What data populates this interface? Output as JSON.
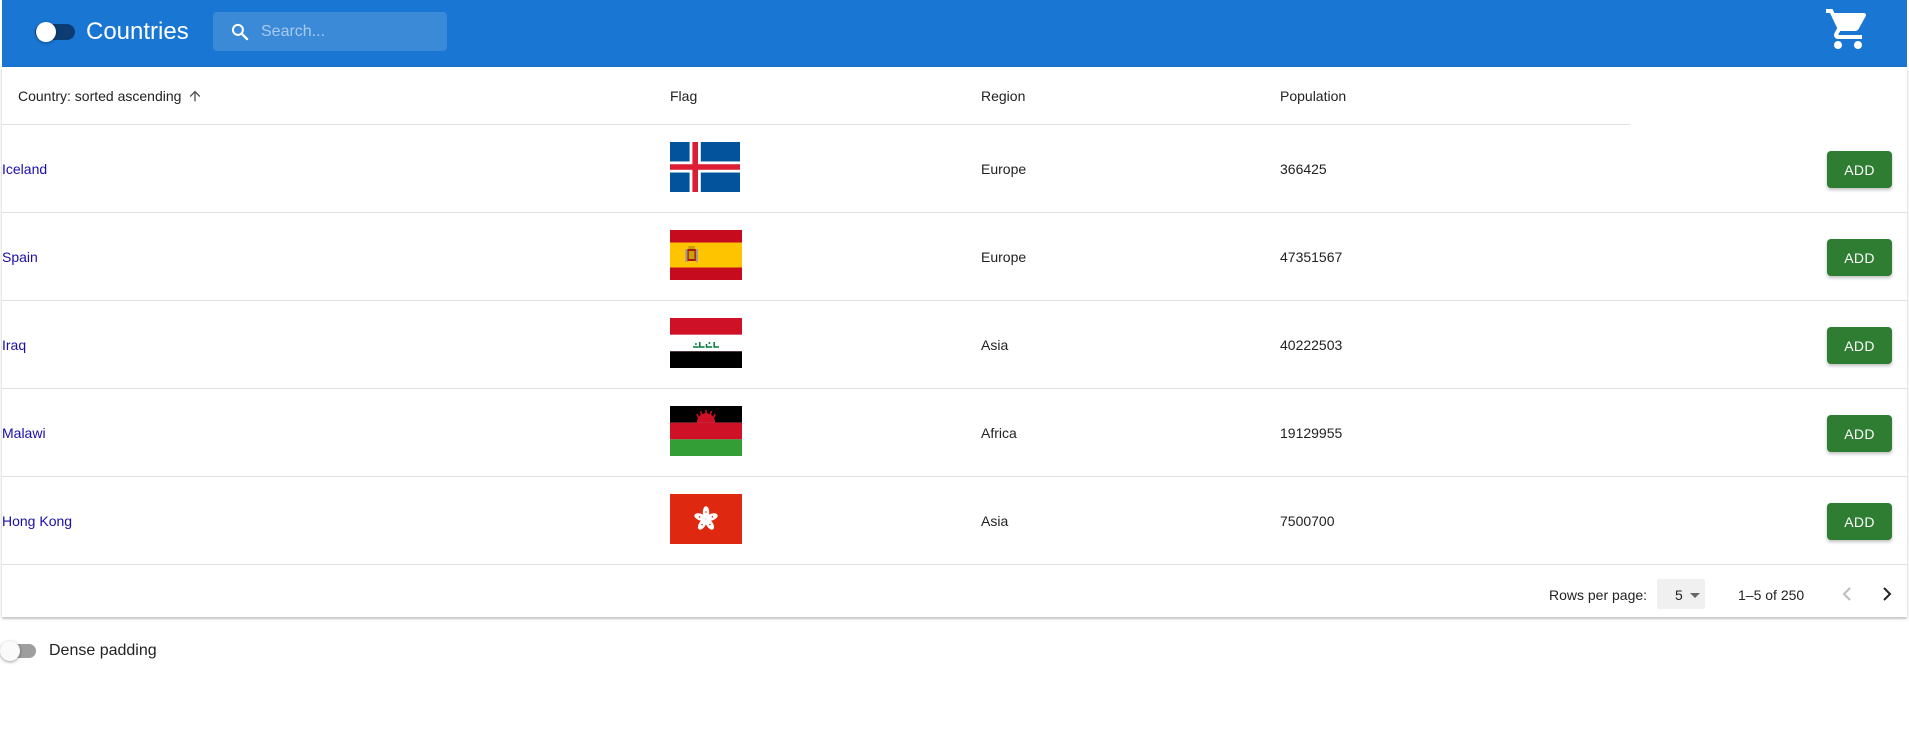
{
  "appbar": {
    "title": "Countries",
    "search_placeholder": "Search...",
    "icons": [
      "search-icon",
      "cart-icon"
    ],
    "color": "#1976d2"
  },
  "table": {
    "columns": {
      "country": "Country: sorted ascending",
      "flag": "Flag",
      "region": "Region",
      "population": "Population"
    },
    "sort": {
      "column": "country",
      "direction": "ascending"
    },
    "rows": [
      {
        "country": "Iceland",
        "flag": "iceland",
        "region": "Europe",
        "population": "366425",
        "action": "ADD"
      },
      {
        "country": "Spain",
        "flag": "spain",
        "region": "Europe",
        "population": "47351567",
        "action": "ADD"
      },
      {
        "country": "Iraq",
        "flag": "iraq",
        "region": "Asia",
        "population": "40222503",
        "action": "ADD"
      },
      {
        "country": "Malawi",
        "flag": "malawi",
        "region": "Africa",
        "population": "19129955",
        "action": "ADD"
      },
      {
        "country": "Hong Kong",
        "flag": "hong-kong",
        "region": "Asia",
        "population": "7500700",
        "action": "ADD"
      }
    ],
    "add_button_color": "#2e7d32",
    "link_color": "#1a0dab"
  },
  "pagination": {
    "rows_per_page_label": "Rows per page:",
    "rows_per_page": "5",
    "range": "1–5 of 250"
  },
  "dense": {
    "label": "Dense padding",
    "enabled": false
  }
}
